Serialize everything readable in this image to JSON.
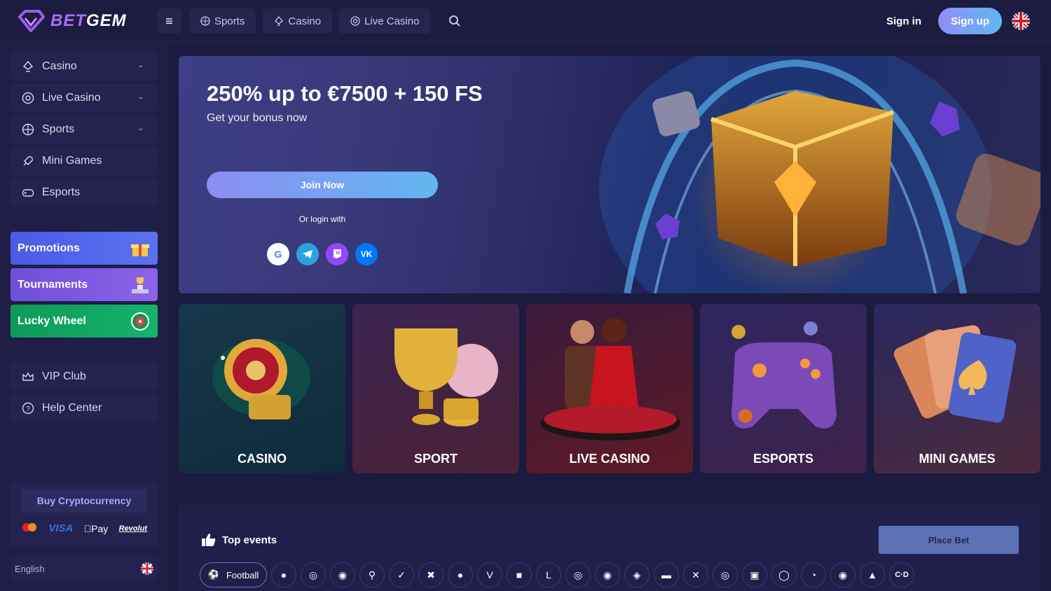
{
  "header": {
    "logo_text_a": "BET",
    "logo_text_b": "GEM",
    "nav": [
      {
        "label": "Sports",
        "icon": "sports-ball-icon"
      },
      {
        "label": "Casino",
        "icon": "casino-icon"
      },
      {
        "label": "Live Casino",
        "icon": "live-casino-icon"
      }
    ],
    "sign_in": "Sign in",
    "sign_up": "Sign up"
  },
  "sidebar": {
    "main_items": [
      {
        "label": "Casino",
        "icon": "casino-icon",
        "expandable": true
      },
      {
        "label": "Live Casino",
        "icon": "live-casino-icon",
        "expandable": true
      },
      {
        "label": "Sports",
        "icon": "sports-ball-icon",
        "expandable": true
      },
      {
        "label": "Mini Games",
        "icon": "rocket-icon",
        "expandable": false
      },
      {
        "label": "Esports",
        "icon": "gamepad-icon",
        "expandable": false
      }
    ],
    "promos": [
      {
        "label": "Promotions",
        "color": "#4a5ee8",
        "icon": "gift-icon"
      },
      {
        "label": "Tournaments",
        "color": "#7b57e0",
        "icon": "trophy-podium-icon"
      },
      {
        "label": "Lucky Wheel",
        "color": "#0f9a5c",
        "icon": "wheel-icon"
      }
    ],
    "bottom_items": [
      {
        "label": "VIP Club",
        "icon": "crown-icon"
      },
      {
        "label": "Help Center",
        "icon": "help-icon"
      }
    ],
    "buy_crypto": "Buy Cryptocurrency",
    "payment_logos": [
      "VISA",
      "Pay",
      "Revolut"
    ],
    "language": "English"
  },
  "banner": {
    "title": "250% up to €7500 + 150 FS",
    "subtitle": "Get your bonus now",
    "join": "Join Now",
    "or_login": "Or login with",
    "social": [
      "google-icon",
      "telegram-icon",
      "twitch-icon",
      "vk-icon"
    ]
  },
  "categories": [
    {
      "label": "CASINO"
    },
    {
      "label": "SPORT"
    },
    {
      "label": "LIVE CASINO"
    },
    {
      "label": "ESPORTS"
    },
    {
      "label": "MINI GAMES"
    }
  ],
  "events": {
    "title": "Top events",
    "place_bet": "Place Bet",
    "active_sport": "Football"
  },
  "colors": {
    "background": "#1b1a3f",
    "accent_gradient_start": "#8f8ef5",
    "accent_gradient_end": "#5fb8f0"
  }
}
